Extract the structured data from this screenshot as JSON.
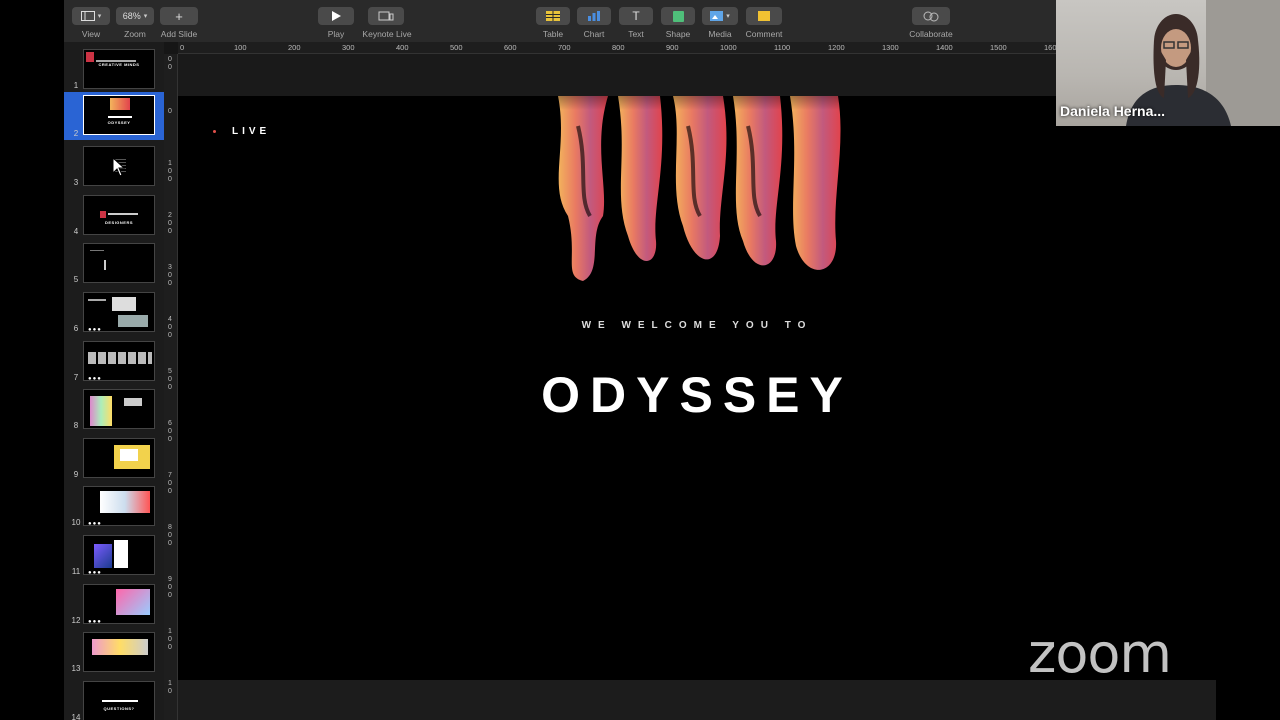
{
  "toolbar": {
    "zoom_value": "68%",
    "items": [
      {
        "label": "View"
      },
      {
        "label": "Zoom"
      },
      {
        "label": "Add Slide"
      },
      {
        "label": "Play"
      },
      {
        "label": "Keynote Live"
      },
      {
        "label": "Table"
      },
      {
        "label": "Chart"
      },
      {
        "label": "Text"
      },
      {
        "label": "Shape"
      },
      {
        "label": "Media"
      },
      {
        "label": "Comment"
      },
      {
        "label": "Collaborate"
      }
    ]
  },
  "ruler": {
    "top_ticks": [
      "0",
      "100",
      "200",
      "300",
      "400",
      "500",
      "600",
      "700",
      "800",
      "900",
      "1000",
      "1100",
      "1200",
      "1300",
      "1400",
      "1500",
      "160"
    ],
    "left_ticks": [
      "0\n0",
      "0",
      "1\n0\n0",
      "2\n0\n0",
      "3\n0\n0",
      "4\n0\n0",
      "5\n0\n0",
      "6\n0\n0",
      "7\n0\n0",
      "8\n0\n0",
      "9\n0\n0",
      "1\n0\n0",
      "1\n0"
    ]
  },
  "navigator": {
    "slides": [
      {
        "number": "1",
        "title": "CREATIVE MINDS"
      },
      {
        "number": "2",
        "title": "ODYSSEY",
        "selected": true
      },
      {
        "number": "3"
      },
      {
        "number": "4",
        "title": "DESIGNERS"
      },
      {
        "number": "5"
      },
      {
        "number": "6",
        "dots": "●●●"
      },
      {
        "number": "7",
        "dots": "●●●"
      },
      {
        "number": "8"
      },
      {
        "number": "9"
      },
      {
        "number": "10",
        "dots": "●●●"
      },
      {
        "number": "11",
        "dots": "●●●"
      },
      {
        "number": "12",
        "dots": "●●●"
      },
      {
        "number": "13"
      },
      {
        "number": "14",
        "title": "QUESTIONS?"
      }
    ]
  },
  "slide": {
    "live_label": "LIVE",
    "welcome_text": "WE WELCOME YOU TO",
    "title": "ODYSSEY"
  },
  "participant": {
    "name": "Daniela Herna..."
  },
  "branding": {
    "zoom_logo": "zoom"
  },
  "colors": {
    "selection": "#2a64d4",
    "toolbar_bg": "#2a2a2a",
    "slide_bg": "#000000",
    "accent_red": "#e0504a"
  }
}
